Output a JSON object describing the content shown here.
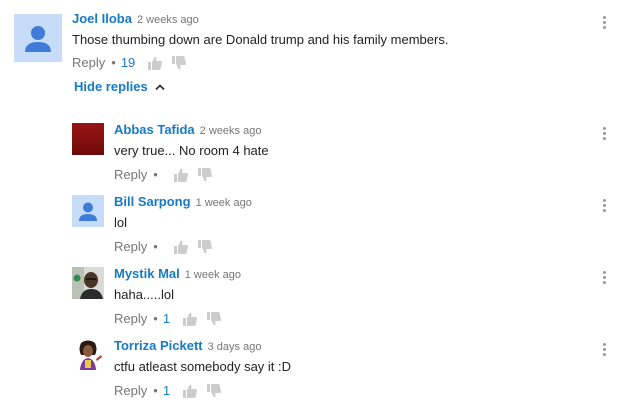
{
  "comment": {
    "author": "Joel Iloba",
    "time": "2 weeks ago",
    "text": "Those thumbing down are Donald trump and his family members.",
    "reply_label": "Reply",
    "separator": "•",
    "likes": "19",
    "avatar_icon": "default-user-avatar-icon"
  },
  "hide_replies_label": "Hide replies",
  "replies": [
    {
      "author": "Abbas Tafida",
      "time": "2 weeks ago",
      "text": "very true... No room 4 hate",
      "reply_label": "Reply",
      "separator": "•",
      "likes": "",
      "avatar_icon": "dark-red-avatar-icon"
    },
    {
      "author": "Bill Sarpong",
      "time": "1 week ago",
      "text": "lol",
      "reply_label": "Reply",
      "separator": "•",
      "likes": "",
      "avatar_icon": "default-user-avatar-icon"
    },
    {
      "author": "Mystik Mal",
      "time": "1 week ago",
      "text": "haha.....lol",
      "reply_label": "Reply",
      "separator": "•",
      "likes": "1",
      "avatar_icon": "photo-avatar-icon"
    },
    {
      "author": "Torriza Pickett",
      "time": "3 days ago",
      "text": "ctfu atleast somebody say it :D",
      "reply_label": "Reply",
      "separator": "•",
      "likes": "1",
      "avatar_icon": "cartoon-avatar-icon"
    }
  ],
  "colors": {
    "link_blue": "#167ac6",
    "meta_gray": "#767676",
    "icon_gray": "#cccccc",
    "avatar_blue": "#c4d9f5",
    "avatar_figure": "#3f7cd8",
    "avatar_dark_red": "#8b0f0f"
  }
}
